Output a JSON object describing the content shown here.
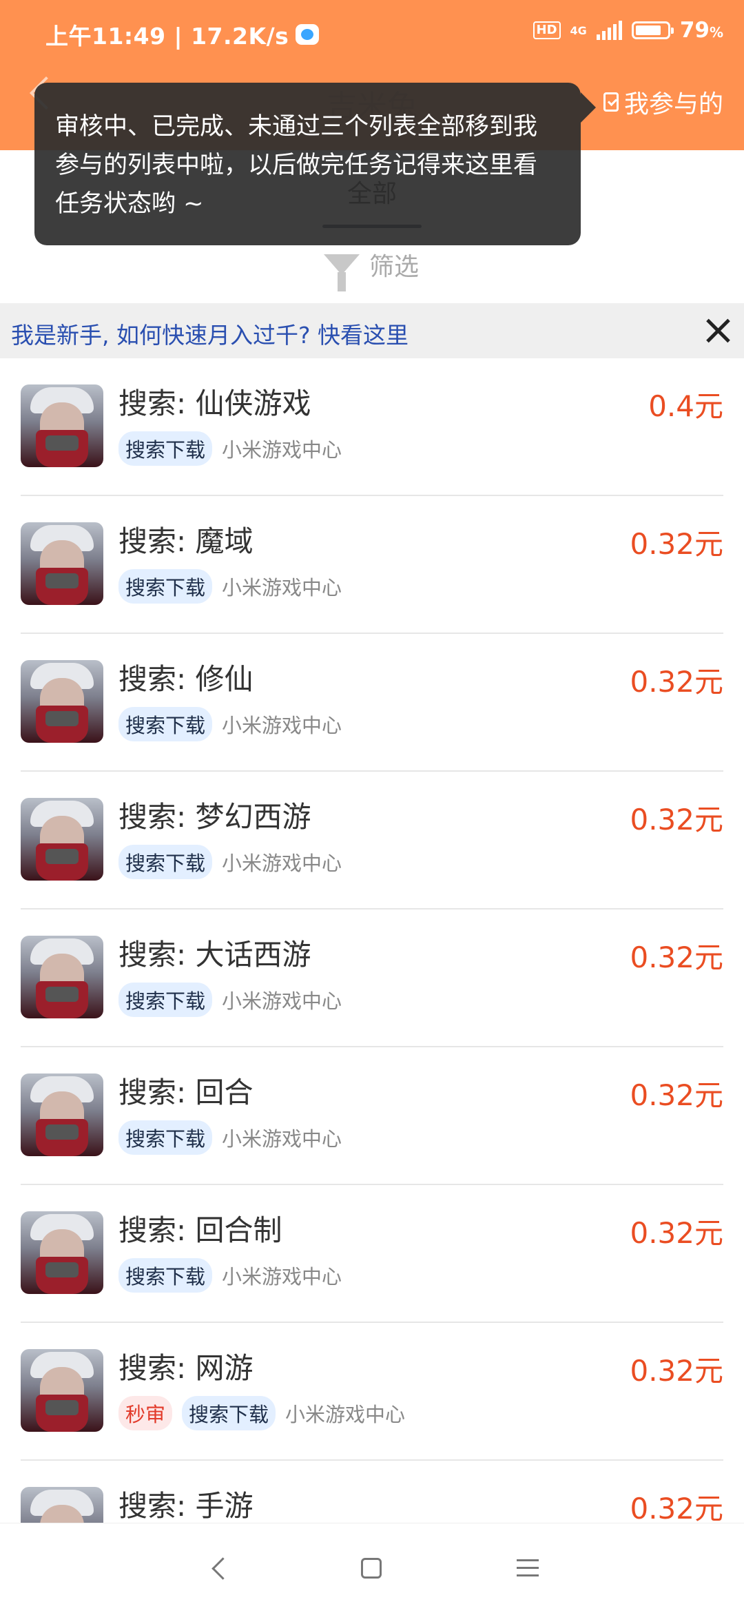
{
  "status": {
    "time_speed": "上午11:49 | 17.2K/s",
    "hd": "HD",
    "net": "4G",
    "battery_pct": "79",
    "battery_unit": "%"
  },
  "header": {
    "title": "吉米兔",
    "my_participated": "我参与的"
  },
  "tabs": {
    "all": "全部"
  },
  "filter": {
    "label": "筛选"
  },
  "tooltip": {
    "text": "审核中、已完成、未通过三个列表全部移到我参与的列表中啦，以后做完任务记得来这里看任务状态哟 ~"
  },
  "banner": {
    "text": "我是新手, 如何快速月入过千? 快看这里"
  },
  "tasks": [
    {
      "title": "搜索: 仙侠游戏",
      "price": "0.4元",
      "tag1": "搜索下载",
      "source": "小米游戏中心"
    },
    {
      "title": "搜索: 魔域",
      "price": "0.32元",
      "tag1": "搜索下载",
      "source": "小米游戏中心"
    },
    {
      "title": "搜索: 修仙",
      "price": "0.32元",
      "tag1": "搜索下载",
      "source": "小米游戏中心"
    },
    {
      "title": "搜索: 梦幻西游",
      "price": "0.32元",
      "tag1": "搜索下载",
      "source": "小米游戏中心"
    },
    {
      "title": "搜索: 大话西游",
      "price": "0.32元",
      "tag1": "搜索下载",
      "source": "小米游戏中心"
    },
    {
      "title": "搜索: 回合",
      "price": "0.32元",
      "tag1": "搜索下载",
      "source": "小米游戏中心"
    },
    {
      "title": "搜索: 回合制",
      "price": "0.32元",
      "tag1": "搜索下载",
      "source": "小米游戏中心"
    },
    {
      "title": "搜索: 网游",
      "price": "0.32元",
      "tag0": "秒审",
      "tag1": "搜索下载",
      "source": "小米游戏中心"
    },
    {
      "title": "搜索: 手游",
      "price": "0.32元"
    }
  ]
}
